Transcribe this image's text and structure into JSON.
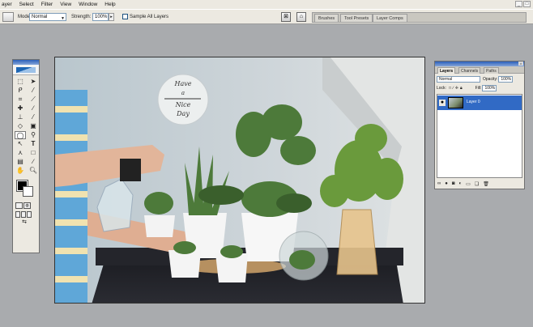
{
  "menu": [
    "ayer",
    "Select",
    "Filter",
    "View",
    "Window",
    "Help"
  ],
  "window_controls": [
    "_",
    "□"
  ],
  "options": {
    "mode_label": "Mode:",
    "mode_value": "Normal",
    "strength_label": "Strength:",
    "strength_value": "100%",
    "sample_all_layers": "Sample All Layers"
  },
  "palette_well": [
    "Brushes",
    "Tool Presets",
    "Layer Comps"
  ],
  "layers_panel": {
    "tabs": [
      "Layers",
      "Channels",
      "Paths"
    ],
    "blend_mode": "Normal",
    "opacity_label": "Opacity:",
    "opacity_value": "100%",
    "lock_label": "Lock:",
    "fill_label": "Fill:",
    "fill_value": "100%",
    "layer_name": "Layer 0",
    "footer_icons": [
      "link-icon",
      "fx-icon",
      "mask-icon",
      "adjustment-icon",
      "folder-icon",
      "new-layer-icon",
      "trash-icon"
    ]
  },
  "canvas_sign": [
    "Have",
    "a",
    "Nice",
    "Day"
  ],
  "colors": {
    "selection": "#316ac5",
    "panel": "#ece9e1",
    "workspace": "#a9abae"
  }
}
